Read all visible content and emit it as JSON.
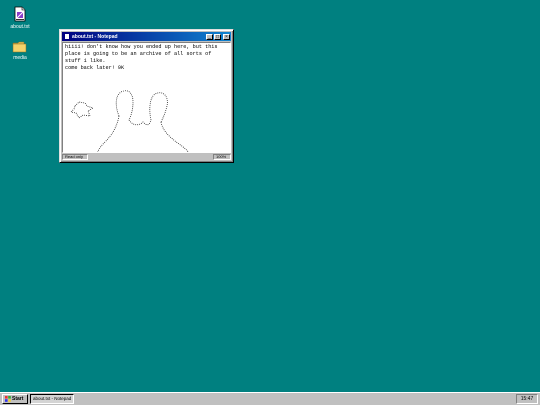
{
  "desktop": {
    "background": "#008080",
    "icons": [
      {
        "label": "about.txt",
        "icon": "text-file-icon"
      },
      {
        "label": "media",
        "icon": "folder-icon"
      }
    ]
  },
  "window": {
    "title": "about.txt - Notepad",
    "content_lines": [
      "hiiii! don't know how you ended up here, but this",
      "place is going to be an archive of all sorts of",
      "stuff i like.",
      "come back later! 9K"
    ],
    "status_left": "Read only",
    "status_right": "100%",
    "controls": {
      "minimize": "_",
      "maximize": "□",
      "close": "×"
    }
  },
  "taskbar": {
    "start_label": "Start",
    "task_label": "about.txt - Notepad",
    "clock": "15:47"
  },
  "colors": {
    "titlebar_start": "#000080",
    "titlebar_end": "#1084d0",
    "face": "#c0c0c0"
  }
}
